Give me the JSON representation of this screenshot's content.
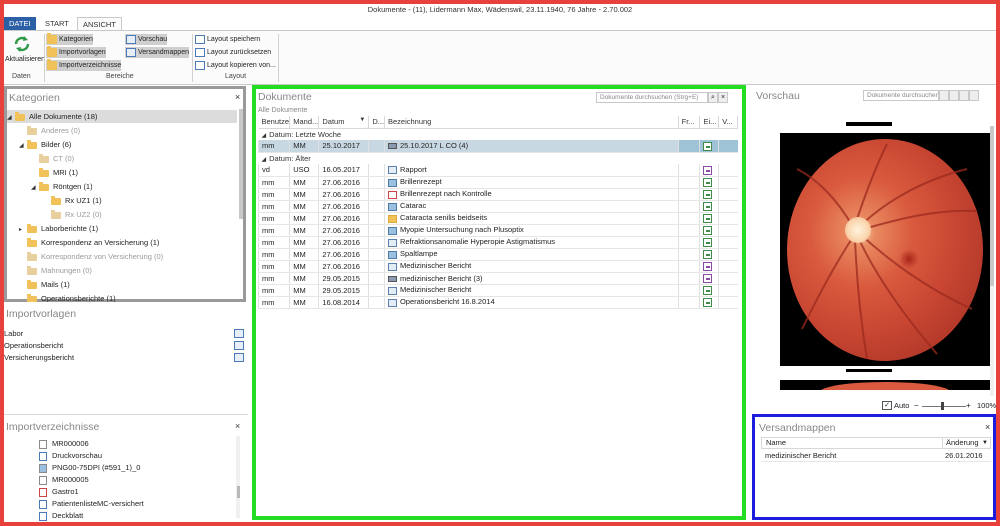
{
  "window": {
    "title": "Dokumente - (11), Lidermann Max, Wädenswil, 23.11.1940, 76 Jahre - 2.70.002"
  },
  "ribbon": {
    "tabs": [
      "DATEI",
      "START",
      "ANSICHT"
    ],
    "daten": {
      "group": "Daten",
      "refresh": "Aktualisieren"
    },
    "bereiche": {
      "group": "Bereiche",
      "items": [
        "Kategorien",
        "Importvorlagen",
        "Importverzeichnisse",
        "Vorschau",
        "Versandmappen"
      ]
    },
    "layout": {
      "group": "Layout",
      "items": [
        "Layout speichern",
        "Layout zurücksetzen",
        "Layout kopieren von..."
      ]
    }
  },
  "kategorien": {
    "title": "Kategorien",
    "items": [
      {
        "label": "Alle Dokumente (18)",
        "muted": false
      },
      {
        "label": "Anderes (0)",
        "muted": true
      },
      {
        "label": "Bilder (6)",
        "muted": false
      },
      {
        "label": "CT (0)",
        "muted": true
      },
      {
        "label": "MRI (1)",
        "muted": false
      },
      {
        "label": "Röntgen (1)",
        "muted": false
      },
      {
        "label": "Rx UZ1 (1)",
        "muted": false
      },
      {
        "label": "Rx UZ2 (0)",
        "muted": true
      },
      {
        "label": "Laborberichte (1)",
        "muted": false
      },
      {
        "label": "Korrespondenz an Versicherung (1)",
        "muted": false
      },
      {
        "label": "Korrespondenz von Versicherung (0)",
        "muted": true
      },
      {
        "label": "Mahnungen (0)",
        "muted": true
      },
      {
        "label": "Mails (1)",
        "muted": false
      },
      {
        "label": "Operationsberichte (1)",
        "muted": false
      }
    ]
  },
  "importvorlagen": {
    "title": "Importvorlagen",
    "items": [
      "Labor",
      "Operationsbericht",
      "Versicherungsbericht"
    ]
  },
  "importverzeichnisse": {
    "title": "Importverzeichnisse",
    "items": [
      "MR000006",
      "Druckvorschau",
      "PNG00-75DPI (#591_1)_0",
      "MR000005",
      "Gastro1",
      "PatientenlisteMC-versichert",
      "Deckblatt"
    ]
  },
  "dokumente": {
    "title": "Dokumente",
    "search_placeholder": "Dokumente durchsuchen (Strg+E)",
    "filter": "Alle Dokumente",
    "columns": [
      "Benutzer",
      "Mand...",
      "Datum",
      "D...",
      "Bezeichnung",
      "Fr...",
      "Ei...",
      "V..."
    ],
    "groups": [
      {
        "label": "Datum: Letzte Woche",
        "rows": [
          {
            "user": "mm",
            "mand": "MM",
            "date": "25.10.2017",
            "icon": "scan",
            "name": "25.10.2017 L CO (4)",
            "action": "green"
          }
        ]
      },
      {
        "label": "Datum: Älter",
        "rows": [
          {
            "user": "vd",
            "mand": "USO",
            "date": "16.05.2017",
            "icon": "doc",
            "name": "Rapport",
            "action": "purple"
          },
          {
            "user": "mm",
            "mand": "MM",
            "date": "27.06.2016",
            "icon": "img",
            "name": "Brillenrezept",
            "action": "green"
          },
          {
            "user": "mm",
            "mand": "MM",
            "date": "27.06.2016",
            "icon": "pdf",
            "name": "Brillenrezept nach Kontrolle",
            "action": "green"
          },
          {
            "user": "mm",
            "mand": "MM",
            "date": "27.06.2016",
            "icon": "img",
            "name": "Catarac",
            "action": "green"
          },
          {
            "user": "mm",
            "mand": "MM",
            "date": "27.06.2016",
            "icon": "fold",
            "name": "Cataracta senilis beidseits",
            "action": "green"
          },
          {
            "user": "mm",
            "mand": "MM",
            "date": "27.06.2016",
            "icon": "img",
            "name": "Myopie Untersuchung nach Plusoptix",
            "action": "green"
          },
          {
            "user": "mm",
            "mand": "MM",
            "date": "27.06.2016",
            "icon": "doc",
            "name": "Refraktionsanomalie Hyperopie Astigmatismus",
            "action": "green"
          },
          {
            "user": "mm",
            "mand": "MM",
            "date": "27.06.2016",
            "icon": "img",
            "name": "Spaltlampe",
            "action": "green"
          },
          {
            "user": "mm",
            "mand": "MM",
            "date": "27.06.2016",
            "icon": "doc",
            "name": "Medizinischer Bericht",
            "action": "purple"
          },
          {
            "user": "mm",
            "mand": "MM",
            "date": "29.05.2015",
            "icon": "scan",
            "name": "medizinischer Bericht (3)",
            "action": "purple"
          },
          {
            "user": "mm",
            "mand": "MM",
            "date": "29.05.2015",
            "icon": "doc",
            "name": "Medizinischer Bericht",
            "action": "green"
          },
          {
            "user": "mm",
            "mand": "MM",
            "date": "16.08.2014",
            "icon": "doc",
            "name": "Operationsbericht 16.8.2014",
            "action": "green"
          }
        ]
      }
    ]
  },
  "vorschau": {
    "title": "Vorschau",
    "search_placeholder": "Dokumente durchsuchen",
    "auto_label": "Auto",
    "auto_checked": true,
    "zoom": "100%"
  },
  "versandmappen": {
    "title": "Versandmappen",
    "columns": [
      "Name",
      "Änderung"
    ],
    "rows": [
      {
        "name": "medizinischer Bericht",
        "date": "26.01.2016"
      }
    ]
  },
  "annotation_colors": {
    "outer": "#e8413c",
    "kategorien": "#9a9a9a",
    "dokumente": "#22dd22",
    "versandmappen": "#1d1ddd"
  }
}
